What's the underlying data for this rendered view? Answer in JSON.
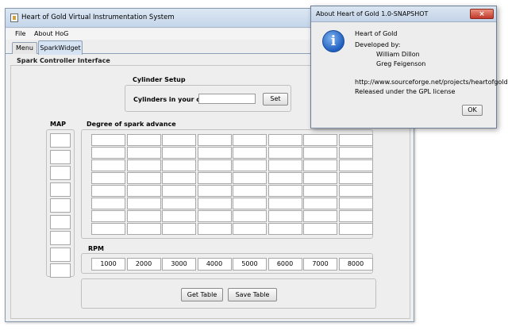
{
  "main_window": {
    "title": "Heart of Gold Virtual Instrumentation System",
    "menu": [
      "File",
      "About HoG"
    ],
    "tabs": [
      {
        "label": "Menu",
        "active": false
      },
      {
        "label": "SparkWidget",
        "active": true
      }
    ],
    "panel_title": "Spark Controller Interface",
    "cylinder_setup": {
      "title": "Cylinder Setup",
      "label": "Cylinders in your car:",
      "value": "",
      "set_button": "Set"
    },
    "map_label": "MAP",
    "map_rows": 9,
    "spark_table": {
      "title": "Degree of spark advance",
      "rows": 8,
      "cols": 8
    },
    "rpm": {
      "label": "RPM",
      "values": [
        "1000",
        "2000",
        "3000",
        "4000",
        "5000",
        "6000",
        "7000",
        "8000"
      ]
    },
    "buttons": {
      "get_table": "Get Table",
      "save_table": "Save Table"
    }
  },
  "about_dialog": {
    "title": "About Heart of Gold 1.0-SNAPSHOT",
    "close_symbol": "×",
    "icon_glyph": "i",
    "lines": {
      "name": "Heart of Gold",
      "developed_by": "Developed by:",
      "dev1": "William Dillon",
      "dev2": "Greg Feigenson",
      "url": "http://www.sourceforge.net/projects/heartofgold",
      "license": "Released under the GPL license"
    },
    "ok_button": "OK"
  }
}
